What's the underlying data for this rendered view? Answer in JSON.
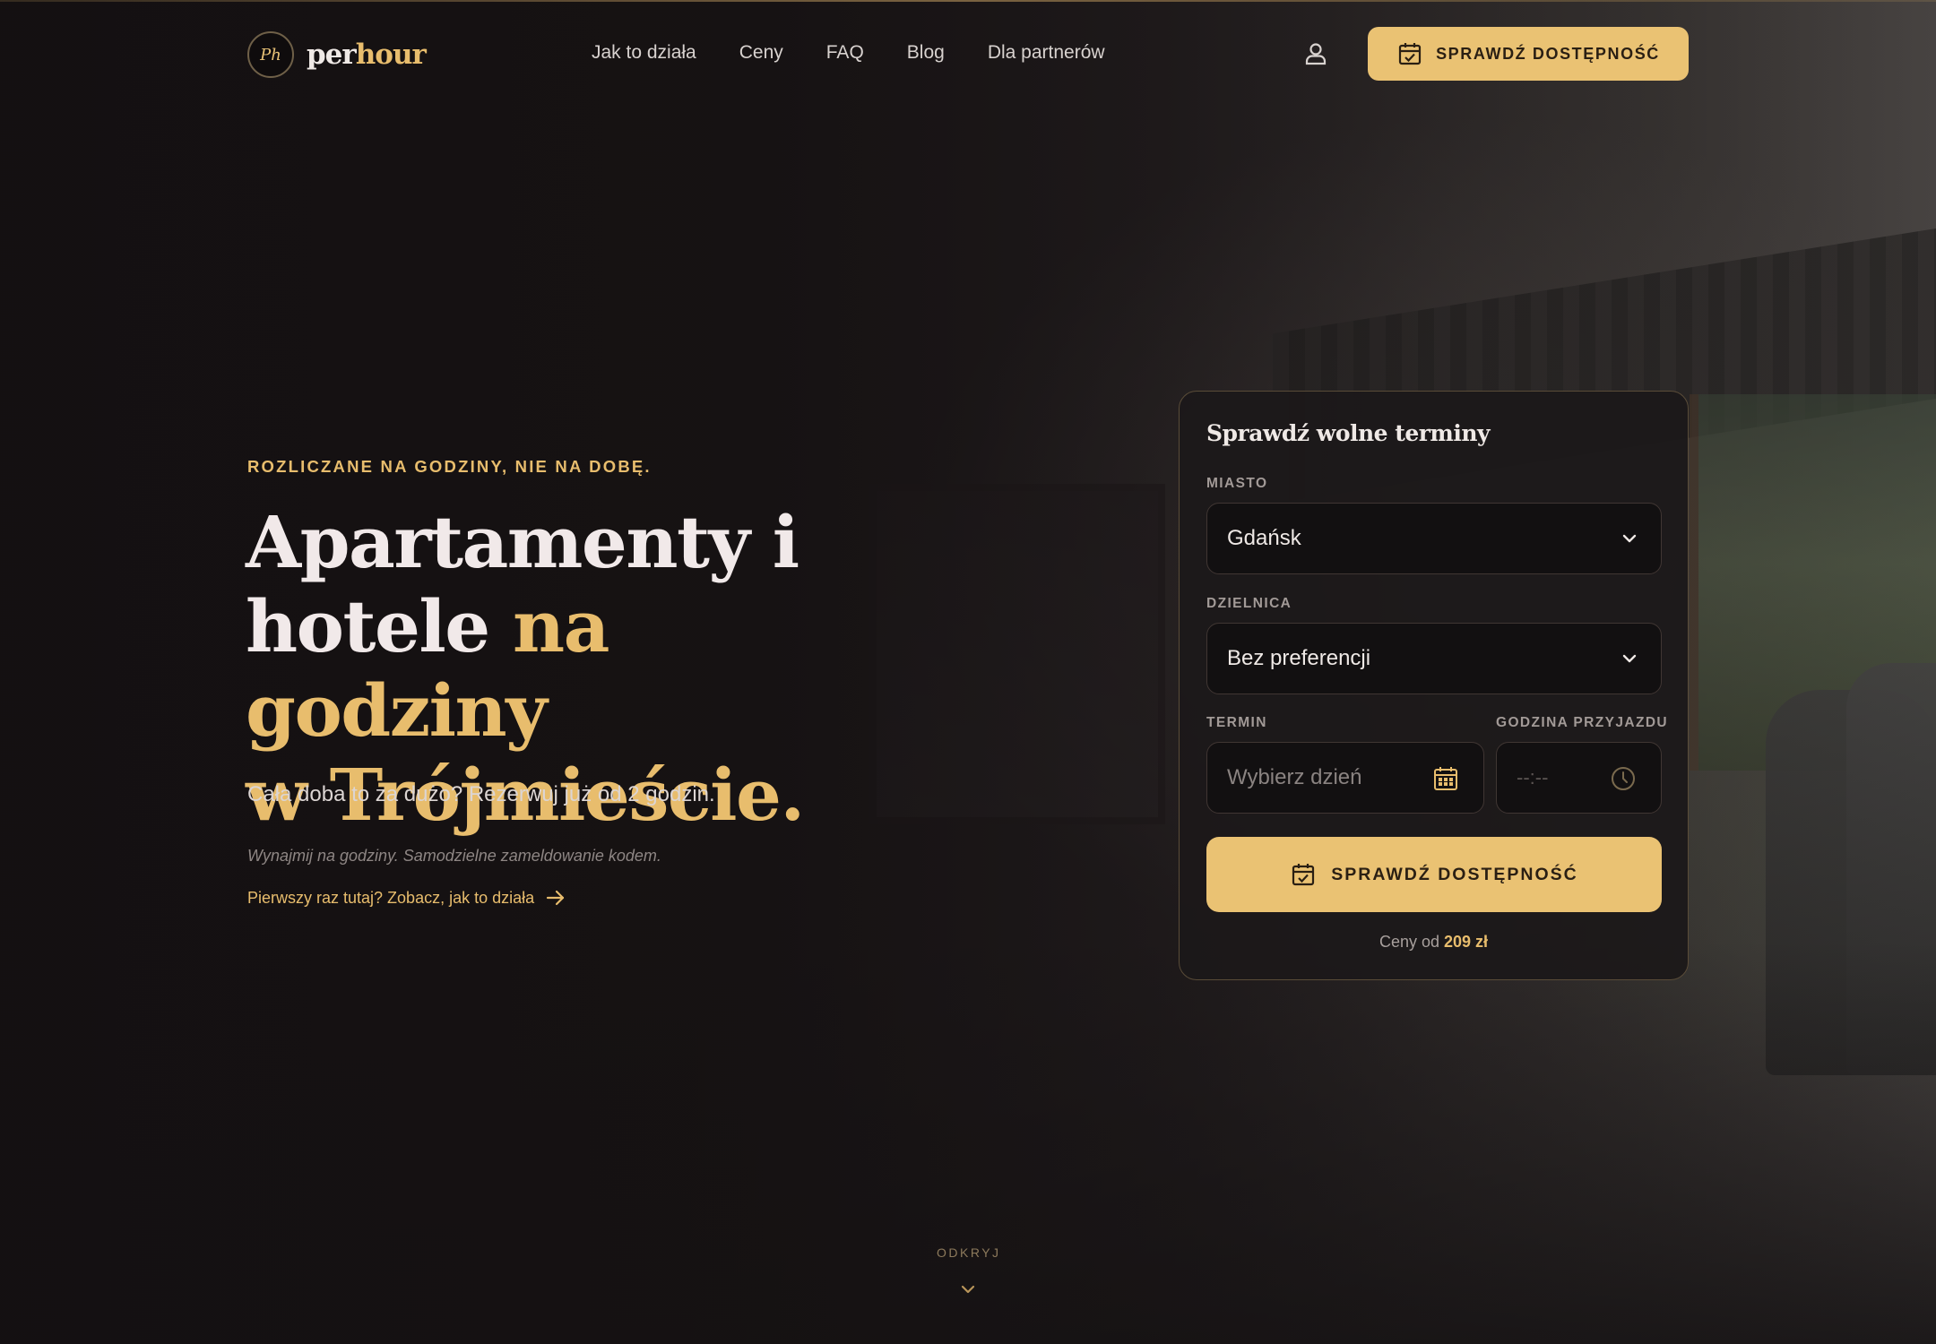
{
  "brand": {
    "logo_monogram": "Ph",
    "name_part1": "per",
    "name_part2": "hour"
  },
  "nav": {
    "items": [
      {
        "label": "Jak to działa"
      },
      {
        "label": "Ceny"
      },
      {
        "label": "FAQ"
      },
      {
        "label": "Blog"
      },
      {
        "label": "Dla partnerów"
      }
    ],
    "user_icon": "user-icon",
    "cta_label": "SPRAWDŹ DOSTĘPNOŚĆ",
    "cta_icon": "calendar-check-icon"
  },
  "hero": {
    "eyebrow": "ROZLICZANE NA GODZINY, NIE NA DOBĘ.",
    "headline_line1": "Apartamenty i",
    "headline_line2_plain": "hotele ",
    "headline_line2_gold": "na godziny",
    "headline_line3_gold": "w Trójmieście.",
    "lead": "Cała doba to za dużo? Rezerwuj już od 2 godzin.",
    "note": "Wynajmij na godziny. Samodzielne zameldowanie kodem.",
    "link": "Pierwszy raz tutaj? Zobacz, jak to działa"
  },
  "booking": {
    "title": "Sprawdź wolne terminy",
    "city_label": "MIASTO",
    "city_value": "Gdańsk",
    "district_label": "DZIELNICA",
    "district_value": "Bez preferencji",
    "date_label": "TERMIN",
    "date_placeholder": "Wybierz dzień",
    "time_label": "GODZINA PRZYJAZDU",
    "time_placeholder": "--:--",
    "cta_label": "SPRAWDŹ DOSTĘPNOŚĆ",
    "price_prefix": "Ceny od ",
    "price_value": "209 zł"
  },
  "scroll_hint": {
    "label": "ODKRYJ"
  },
  "colors": {
    "accent": "#eac273",
    "background": "#1a1617",
    "text": "#efe9e6"
  }
}
